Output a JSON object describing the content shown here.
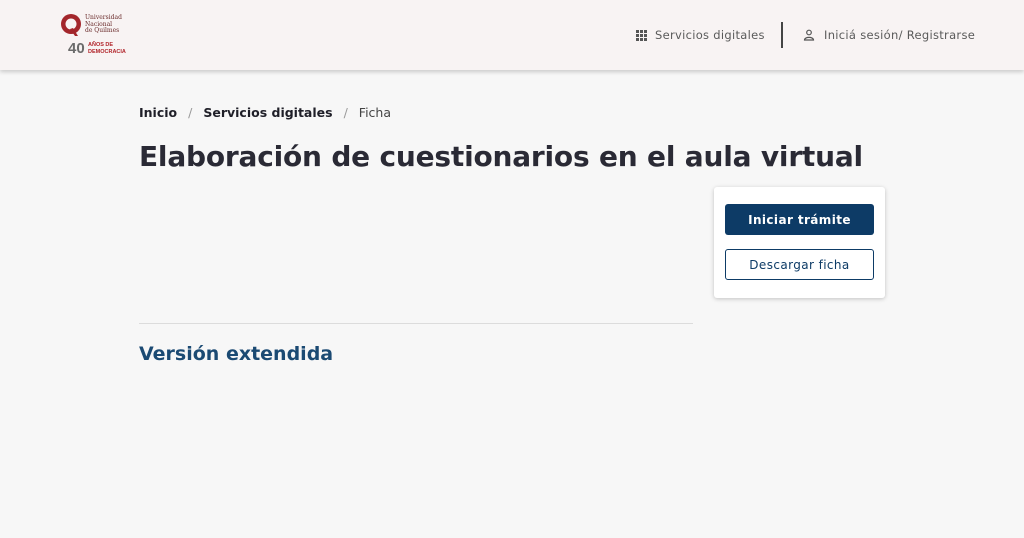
{
  "header": {
    "logo": {
      "university_lines": [
        "Universidad",
        "Nacional",
        "de Quilmes"
      ],
      "anniversary_number": "40",
      "anniversary_lines": [
        "AÑOS DE",
        "DEMOCRACIA"
      ]
    },
    "nav_servicios_label": "Servicios digitales",
    "nav_login_label": "Iniciá sesión/ Registrarse"
  },
  "breadcrumb": {
    "items": [
      "Inicio",
      "Servicios digitales",
      "Ficha"
    ]
  },
  "page": {
    "title": "Elaboración de cuestionarios en el aula virtual",
    "section_title": "Versión extendida"
  },
  "actions": {
    "primary_label": "Iniciar trámite",
    "secondary_label": "Descargar ficha"
  },
  "colors": {
    "primary": "#0d3b66",
    "section_title": "#1b4a73",
    "brand_red": "#b1242a"
  }
}
